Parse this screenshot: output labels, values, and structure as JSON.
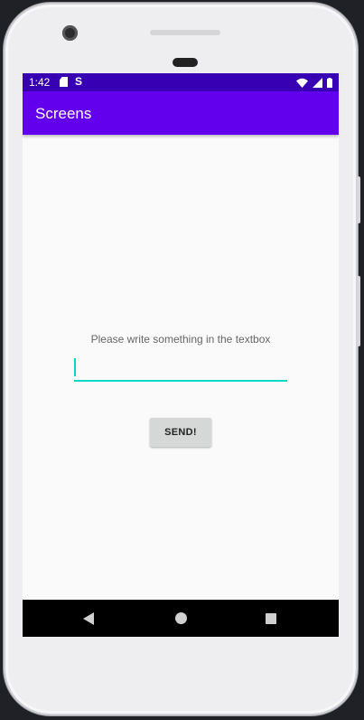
{
  "status_bar": {
    "time": "1:42",
    "icons_left": [
      "sd-card-icon",
      "sync-icon"
    ],
    "icons_right": [
      "wifi-icon",
      "signal-icon",
      "battery-icon"
    ],
    "background_color": "#3700b3"
  },
  "app_bar": {
    "title": "Screens",
    "background_color": "#6200ee"
  },
  "main": {
    "prompt": "Please write something in the textbox",
    "textbox": {
      "value": "",
      "accent_color": "#03dac5"
    },
    "send_button_label": "SEND!"
  },
  "nav_bar": {
    "buttons": [
      "back-icon",
      "home-icon",
      "recents-icon"
    ]
  }
}
